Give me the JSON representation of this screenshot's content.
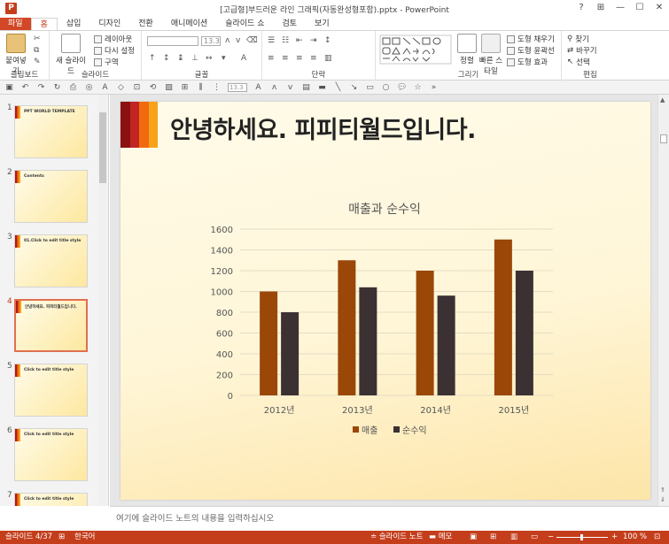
{
  "window": {
    "title": "[고급형]부드러운 라인 그래픽(자동완성형포함).pptx - PowerPoint",
    "app_icon": "P",
    "controls": [
      "?",
      "⊞",
      "—",
      "☐",
      "✕"
    ]
  },
  "tabs": [
    {
      "label": "파일"
    },
    {
      "label": "홈"
    },
    {
      "label": "삽입"
    },
    {
      "label": "디자인"
    },
    {
      "label": "전환"
    },
    {
      "label": "애니메이션"
    },
    {
      "label": "슬라이드 쇼"
    },
    {
      "label": "검토"
    },
    {
      "label": "보기"
    }
  ],
  "ribbon": {
    "clipboard": {
      "label": "클립보드",
      "paste": "붙여넣기"
    },
    "slides": {
      "label": "슬라이드",
      "new_slide": "새 슬라이드",
      "layout": "레이아웃",
      "reset": "다시 설정",
      "section": "구역"
    },
    "font": {
      "label": "글꼴",
      "size": "13.3"
    },
    "paragraph": {
      "label": "단락"
    },
    "drawing": {
      "label": "그리기",
      "arrange": "정렬",
      "quick_styles": "빠른 스타일",
      "fill": "도형 채우기",
      "outline": "도형 윤곽선",
      "effects": "도형 효과"
    },
    "editing": {
      "label": "편집",
      "find": "찾기",
      "replace": "바꾸기",
      "select": "선택"
    }
  },
  "toolbar2": {
    "size": "13.3"
  },
  "slides_panel": {
    "thumbs": [
      {
        "num": "1",
        "title": "PPT WORLD TEMPLATE"
      },
      {
        "num": "2",
        "title": "Contents"
      },
      {
        "num": "3",
        "title": "01.Click to edit title style"
      },
      {
        "num": "4",
        "title": "안녕하세요. 피피티월드입니다."
      },
      {
        "num": "5",
        "title": "Click to edit title style"
      },
      {
        "num": "6",
        "title": "Click to edit title style"
      },
      {
        "num": "7",
        "title": "Click to edit title style"
      }
    ]
  },
  "slide": {
    "title": "안녕하세요. 피피티월드입니다."
  },
  "chart_data": {
    "type": "bar",
    "title": "매출과 순수익",
    "categories": [
      "2012년",
      "2013년",
      "2014년",
      "2015년"
    ],
    "series": [
      {
        "name": "매출",
        "values": [
          1000,
          1300,
          1200,
          1500
        ],
        "color": "#9a4708"
      },
      {
        "name": "순수익",
        "values": [
          800,
          1040,
          960,
          1200
        ],
        "color": "#3b3032"
      }
    ],
    "ylim": [
      0,
      1600
    ],
    "yticks": [
      "0",
      "200",
      "400",
      "600",
      "800",
      "1000",
      "1200",
      "1400",
      "1600"
    ],
    "grid": true,
    "legend": "bottom"
  },
  "notes": {
    "placeholder": "여기에 슬라이드 노트의 내용을 입력하십시오"
  },
  "status": {
    "slide": "슬라이드 4/37",
    "language": "한국어",
    "notes": "슬라이드 노트",
    "comments": "메모",
    "zoom": "100 %"
  },
  "colors": {
    "accent": "#c43e1c",
    "bar1": "#9a4708",
    "bar2": "#3b3032"
  }
}
